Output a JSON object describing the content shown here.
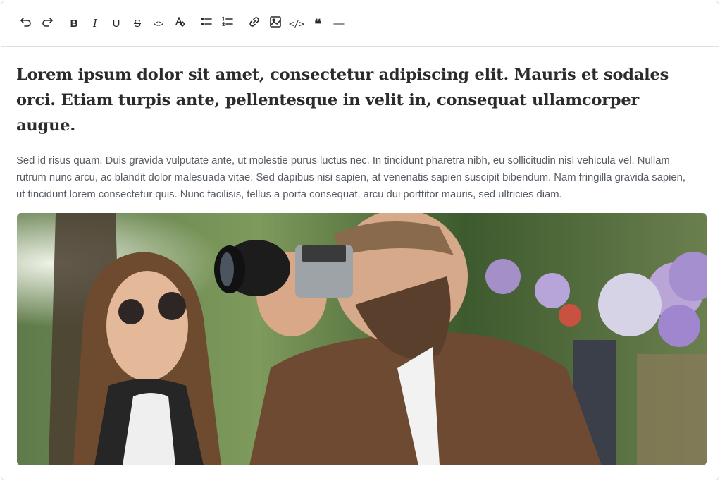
{
  "toolbar": {
    "buttons": [
      {
        "icon": "undo-icon",
        "label": "Undo"
      },
      {
        "icon": "redo-icon",
        "label": "Redo"
      },
      {
        "icon": "bold-icon",
        "label": "Bold",
        "glyph": "B"
      },
      {
        "icon": "italic-icon",
        "label": "Italic",
        "glyph": "I"
      },
      {
        "icon": "underline-icon",
        "label": "Underline",
        "glyph": "U"
      },
      {
        "icon": "strikethrough-icon",
        "label": "Strikethrough",
        "glyph": "S"
      },
      {
        "icon": "inline-code-icon",
        "label": "Inline code",
        "glyph": "<>"
      },
      {
        "icon": "clear-format-icon",
        "label": "Clear formatting"
      },
      {
        "icon": "bullet-list-icon",
        "label": "Bullet list"
      },
      {
        "icon": "ordered-list-icon",
        "label": "Ordered list"
      },
      {
        "icon": "link-icon",
        "label": "Link"
      },
      {
        "icon": "image-icon",
        "label": "Image"
      },
      {
        "icon": "code-block-icon",
        "label": "Code block",
        "glyph": "</>"
      },
      {
        "icon": "blockquote-icon",
        "label": "Blockquote",
        "glyph": "❝"
      },
      {
        "icon": "horizontal-rule-icon",
        "label": "Horizontal rule",
        "glyph": "—"
      }
    ]
  },
  "document": {
    "heading": "Lorem ipsum dolor sit amet, consectetur adipiscing elit. Mauris et sodales orci. Etiam turpis ante, pellentesque in velit in, consequat ullamcorper augue.",
    "paragraph": "Sed id risus quam. Duis gravida vulputate ante, ut molestie purus luctus nec. In tincidunt pharetra nibh, eu sollicitudin nisl vehicula vel. Nullam rutrum nunc arcu, ac blandit dolor malesuada vitae. Sed dapibus nisi sapien, at venenatis sapien suscipit bibendum. Nam fringilla gravida sapien, ut tincidunt lorem consectetur quis. Nunc facilisis, tellus a porta consequat, arcu dui porttitor mauris, sed ultricies diam."
  },
  "colors": {
    "text": "#2b2b2b",
    "paragraph": "#555b63",
    "border": "#dcdfe4"
  }
}
